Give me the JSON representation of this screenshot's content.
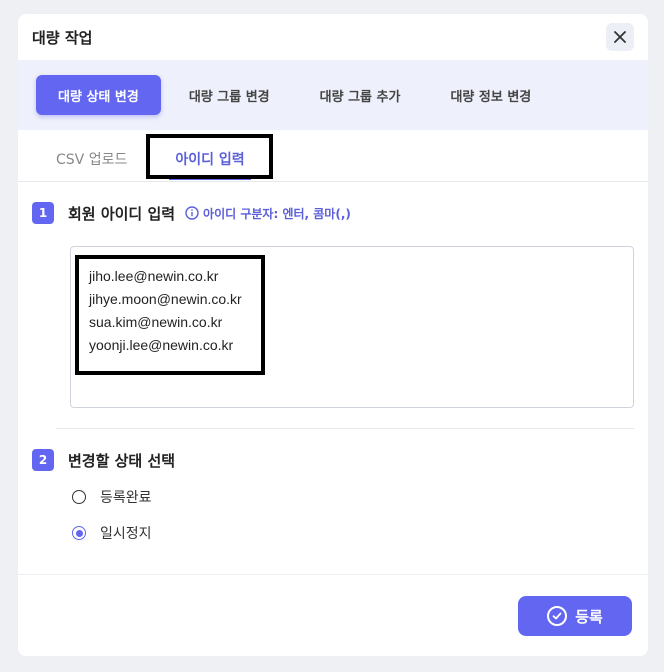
{
  "modal": {
    "title": "대량 작업"
  },
  "top_tabs": [
    {
      "label": "대량 상태 변경",
      "active": true
    },
    {
      "label": "대량 그룹 변경",
      "active": false
    },
    {
      "label": "대량 그룹 추가",
      "active": false
    },
    {
      "label": "대량 정보 변경",
      "active": false
    }
  ],
  "sub_tabs": [
    {
      "label": "CSV 업로드",
      "active": false
    },
    {
      "label": "아이디 입력",
      "active": true
    }
  ],
  "step1": {
    "number": "1",
    "title": "회원 아이디 입력",
    "hint": "아이디 구분자: 엔터, 콤마(,)",
    "ids": [
      "jiho.lee@newin.co.kr",
      "jihye.moon@newin.co.kr",
      "sua.kim@newin.co.kr",
      "yoonji.lee@newin.co.kr"
    ]
  },
  "step2": {
    "number": "2",
    "title": "변경할 상태 선택",
    "options": [
      {
        "label": "등록완료",
        "checked": false
      },
      {
        "label": "일시정지",
        "checked": true
      }
    ]
  },
  "submit_label": "등록",
  "colors": {
    "accent": "#6366f1",
    "tab_bg": "#eef0fb"
  }
}
